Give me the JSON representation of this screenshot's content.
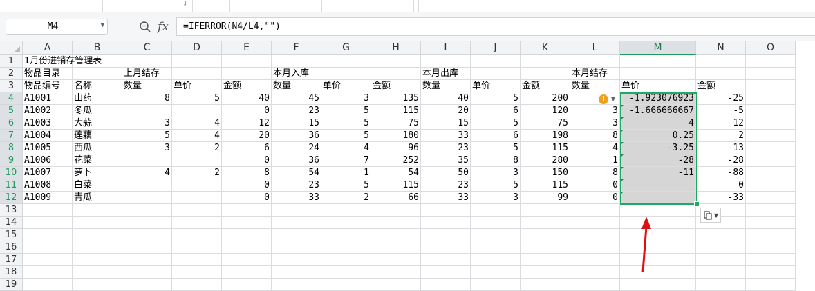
{
  "formula_bar": {
    "name_box": "M4",
    "zoom_icon": "zoom-icon",
    "fx_label": "fx",
    "formula": "=IFERROR(N4/L4,\"\")"
  },
  "columns": [
    "A",
    "B",
    "C",
    "D",
    "E",
    "F",
    "G",
    "H",
    "I",
    "J",
    "K",
    "L",
    "M",
    "N",
    "O"
  ],
  "selected_column": "M",
  "selected_rows": [
    "4",
    "5",
    "6",
    "7",
    "8",
    "9",
    "10",
    "11",
    "12"
  ],
  "rows": [
    {
      "num": "1",
      "cells": {
        "A": "1月份进销存管理表"
      }
    },
    {
      "num": "2",
      "cells": {
        "A": "物品目录",
        "C": "上月结存",
        "F": "本月入库",
        "I": "本月出库",
        "L": "本月结存"
      }
    },
    {
      "num": "3",
      "cells": {
        "A": "物品编号",
        "B": "名称",
        "C": "数量",
        "D": "单价",
        "E": "金额",
        "F": "数量",
        "G": "单价",
        "H": "金额",
        "I": "数量",
        "J": "单价",
        "K": "金额",
        "L": "数量",
        "M": "单价",
        "N": "金额"
      }
    },
    {
      "num": "4",
      "cells": {
        "A": "A1001",
        "B": "山药",
        "C": "8",
        "D": "5",
        "E": "40",
        "F": "45",
        "G": "3",
        "H": "135",
        "I": "40",
        "J": "5",
        "K": "200",
        "M": "-1.923076923",
        "N": "-25"
      }
    },
    {
      "num": "5",
      "cells": {
        "A": "A1002",
        "B": "冬瓜",
        "E": "0",
        "F": "23",
        "G": "5",
        "H": "115",
        "I": "20",
        "J": "6",
        "K": "120",
        "L": "3",
        "M": "-1.666666667",
        "N": "-5"
      }
    },
    {
      "num": "6",
      "cells": {
        "A": "A1003",
        "B": "大蒜",
        "C": "3",
        "D": "4",
        "E": "12",
        "F": "15",
        "G": "5",
        "H": "75",
        "I": "15",
        "J": "5",
        "K": "75",
        "L": "3",
        "M": "4",
        "N": "12"
      }
    },
    {
      "num": "7",
      "cells": {
        "A": "A1004",
        "B": "莲藕",
        "C": "5",
        "D": "4",
        "E": "20",
        "F": "36",
        "G": "5",
        "H": "180",
        "I": "33",
        "J": "6",
        "K": "198",
        "L": "8",
        "M": "0.25",
        "N": "2"
      }
    },
    {
      "num": "8",
      "cells": {
        "A": "A1005",
        "B": "西瓜",
        "C": "3",
        "D": "2",
        "E": "6",
        "F": "24",
        "G": "4",
        "H": "96",
        "I": "23",
        "J": "5",
        "K": "115",
        "L": "4",
        "M": "-3.25",
        "N": "-13"
      }
    },
    {
      "num": "9",
      "cells": {
        "A": "A1006",
        "B": "花菜",
        "E": "0",
        "F": "36",
        "G": "7",
        "H": "252",
        "I": "35",
        "J": "8",
        "K": "280",
        "L": "1",
        "M": "-28",
        "N": "-28"
      }
    },
    {
      "num": "10",
      "cells": {
        "A": "A1007",
        "B": "萝卜",
        "C": "4",
        "D": "2",
        "E": "8",
        "F": "54",
        "G": "1",
        "H": "54",
        "I": "50",
        "J": "3",
        "K": "150",
        "L": "8",
        "M": "-11",
        "N": "-88"
      }
    },
    {
      "num": "11",
      "cells": {
        "A": "A1008",
        "B": "白菜",
        "E": "0",
        "F": "23",
        "G": "5",
        "H": "115",
        "I": "23",
        "J": "5",
        "K": "115",
        "L": "0",
        "N": "0"
      }
    },
    {
      "num": "12",
      "cells": {
        "A": "A1009",
        "B": "青瓜",
        "E": "0",
        "F": "33",
        "G": "2",
        "H": "66",
        "I": "33",
        "J": "3",
        "K": "99",
        "L": "0",
        "N": "-33"
      }
    },
    {
      "num": "13",
      "cells": {}
    },
    {
      "num": "14",
      "cells": {}
    },
    {
      "num": "15",
      "cells": {}
    },
    {
      "num": "16",
      "cells": {}
    },
    {
      "num": "17",
      "cells": {}
    },
    {
      "num": "18",
      "cells": {}
    },
    {
      "num": "19",
      "cells": {}
    }
  ],
  "icons": {
    "warning": "warning-icon",
    "paste_options": "paste-options-icon",
    "annotation_arrow": "red-arrow-icon"
  },
  "colors": {
    "selection": "#1faa63",
    "selected_shade": "#d6d6d6",
    "warning": "#f0a020",
    "arrow": "#e01010"
  }
}
